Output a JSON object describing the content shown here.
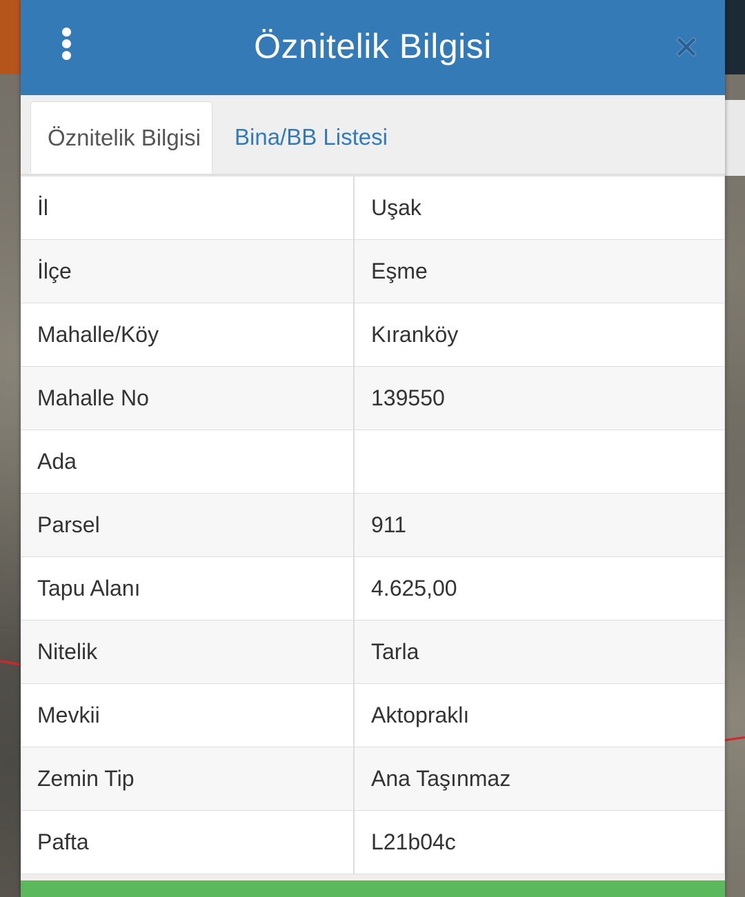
{
  "header": {
    "title": "Öznitelik Bilgisi",
    "menu_icon": "vertical-dots-icon",
    "close_icon": "close-x-icon"
  },
  "tabs": [
    {
      "label": "Öznitelik Bilgisi",
      "active": true
    },
    {
      "label": "Bina/BB Listesi",
      "active": false
    }
  ],
  "attributes": [
    {
      "key": "İl",
      "value": "Uşak"
    },
    {
      "key": "İlçe",
      "value": "Eşme"
    },
    {
      "key": "Mahalle/Köy",
      "value": "Kıranköy"
    },
    {
      "key": "Mahalle No",
      "value": "139550"
    },
    {
      "key": "Ada",
      "value": ""
    },
    {
      "key": "Parsel",
      "value": "911"
    },
    {
      "key": "Tapu Alanı",
      "value": "4.625,00"
    },
    {
      "key": "Nitelik",
      "value": "Tarla"
    },
    {
      "key": "Mevkii",
      "value": "Aktopraklı"
    },
    {
      "key": "Zemin Tip",
      "value": "Ana Taşınmaz"
    },
    {
      "key": "Pafta",
      "value": "L21b04c"
    }
  ],
  "colors": {
    "header": "#337ab7",
    "tab_link": "#337ab7",
    "footer_bar": "#5cb85c"
  }
}
